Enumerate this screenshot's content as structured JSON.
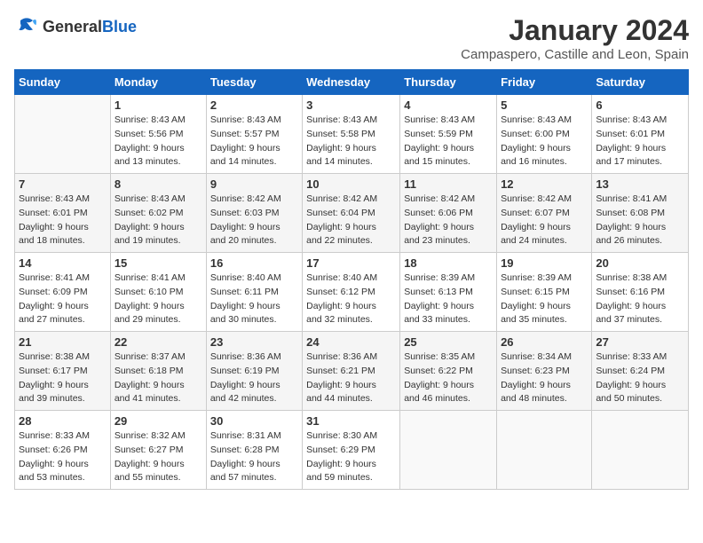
{
  "logo": {
    "general": "General",
    "blue": "Blue"
  },
  "header": {
    "month": "January 2024",
    "location": "Campaspero, Castille and Leon, Spain"
  },
  "weekdays": [
    "Sunday",
    "Monday",
    "Tuesday",
    "Wednesday",
    "Thursday",
    "Friday",
    "Saturday"
  ],
  "weeks": [
    [
      {
        "day": "",
        "info": ""
      },
      {
        "day": "1",
        "info": "Sunrise: 8:43 AM\nSunset: 5:56 PM\nDaylight: 9 hours\nand 13 minutes."
      },
      {
        "day": "2",
        "info": "Sunrise: 8:43 AM\nSunset: 5:57 PM\nDaylight: 9 hours\nand 14 minutes."
      },
      {
        "day": "3",
        "info": "Sunrise: 8:43 AM\nSunset: 5:58 PM\nDaylight: 9 hours\nand 14 minutes."
      },
      {
        "day": "4",
        "info": "Sunrise: 8:43 AM\nSunset: 5:59 PM\nDaylight: 9 hours\nand 15 minutes."
      },
      {
        "day": "5",
        "info": "Sunrise: 8:43 AM\nSunset: 6:00 PM\nDaylight: 9 hours\nand 16 minutes."
      },
      {
        "day": "6",
        "info": "Sunrise: 8:43 AM\nSunset: 6:01 PM\nDaylight: 9 hours\nand 17 minutes."
      }
    ],
    [
      {
        "day": "7",
        "info": "Sunrise: 8:43 AM\nSunset: 6:01 PM\nDaylight: 9 hours\nand 18 minutes."
      },
      {
        "day": "8",
        "info": "Sunrise: 8:43 AM\nSunset: 6:02 PM\nDaylight: 9 hours\nand 19 minutes."
      },
      {
        "day": "9",
        "info": "Sunrise: 8:42 AM\nSunset: 6:03 PM\nDaylight: 9 hours\nand 20 minutes."
      },
      {
        "day": "10",
        "info": "Sunrise: 8:42 AM\nSunset: 6:04 PM\nDaylight: 9 hours\nand 22 minutes."
      },
      {
        "day": "11",
        "info": "Sunrise: 8:42 AM\nSunset: 6:06 PM\nDaylight: 9 hours\nand 23 minutes."
      },
      {
        "day": "12",
        "info": "Sunrise: 8:42 AM\nSunset: 6:07 PM\nDaylight: 9 hours\nand 24 minutes."
      },
      {
        "day": "13",
        "info": "Sunrise: 8:41 AM\nSunset: 6:08 PM\nDaylight: 9 hours\nand 26 minutes."
      }
    ],
    [
      {
        "day": "14",
        "info": "Sunrise: 8:41 AM\nSunset: 6:09 PM\nDaylight: 9 hours\nand 27 minutes."
      },
      {
        "day": "15",
        "info": "Sunrise: 8:41 AM\nSunset: 6:10 PM\nDaylight: 9 hours\nand 29 minutes."
      },
      {
        "day": "16",
        "info": "Sunrise: 8:40 AM\nSunset: 6:11 PM\nDaylight: 9 hours\nand 30 minutes."
      },
      {
        "day": "17",
        "info": "Sunrise: 8:40 AM\nSunset: 6:12 PM\nDaylight: 9 hours\nand 32 minutes."
      },
      {
        "day": "18",
        "info": "Sunrise: 8:39 AM\nSunset: 6:13 PM\nDaylight: 9 hours\nand 33 minutes."
      },
      {
        "day": "19",
        "info": "Sunrise: 8:39 AM\nSunset: 6:15 PM\nDaylight: 9 hours\nand 35 minutes."
      },
      {
        "day": "20",
        "info": "Sunrise: 8:38 AM\nSunset: 6:16 PM\nDaylight: 9 hours\nand 37 minutes."
      }
    ],
    [
      {
        "day": "21",
        "info": "Sunrise: 8:38 AM\nSunset: 6:17 PM\nDaylight: 9 hours\nand 39 minutes."
      },
      {
        "day": "22",
        "info": "Sunrise: 8:37 AM\nSunset: 6:18 PM\nDaylight: 9 hours\nand 41 minutes."
      },
      {
        "day": "23",
        "info": "Sunrise: 8:36 AM\nSunset: 6:19 PM\nDaylight: 9 hours\nand 42 minutes."
      },
      {
        "day": "24",
        "info": "Sunrise: 8:36 AM\nSunset: 6:21 PM\nDaylight: 9 hours\nand 44 minutes."
      },
      {
        "day": "25",
        "info": "Sunrise: 8:35 AM\nSunset: 6:22 PM\nDaylight: 9 hours\nand 46 minutes."
      },
      {
        "day": "26",
        "info": "Sunrise: 8:34 AM\nSunset: 6:23 PM\nDaylight: 9 hours\nand 48 minutes."
      },
      {
        "day": "27",
        "info": "Sunrise: 8:33 AM\nSunset: 6:24 PM\nDaylight: 9 hours\nand 50 minutes."
      }
    ],
    [
      {
        "day": "28",
        "info": "Sunrise: 8:33 AM\nSunset: 6:26 PM\nDaylight: 9 hours\nand 53 minutes."
      },
      {
        "day": "29",
        "info": "Sunrise: 8:32 AM\nSunset: 6:27 PM\nDaylight: 9 hours\nand 55 minutes."
      },
      {
        "day": "30",
        "info": "Sunrise: 8:31 AM\nSunset: 6:28 PM\nDaylight: 9 hours\nand 57 minutes."
      },
      {
        "day": "31",
        "info": "Sunrise: 8:30 AM\nSunset: 6:29 PM\nDaylight: 9 hours\nand 59 minutes."
      },
      {
        "day": "",
        "info": ""
      },
      {
        "day": "",
        "info": ""
      },
      {
        "day": "",
        "info": ""
      }
    ]
  ]
}
